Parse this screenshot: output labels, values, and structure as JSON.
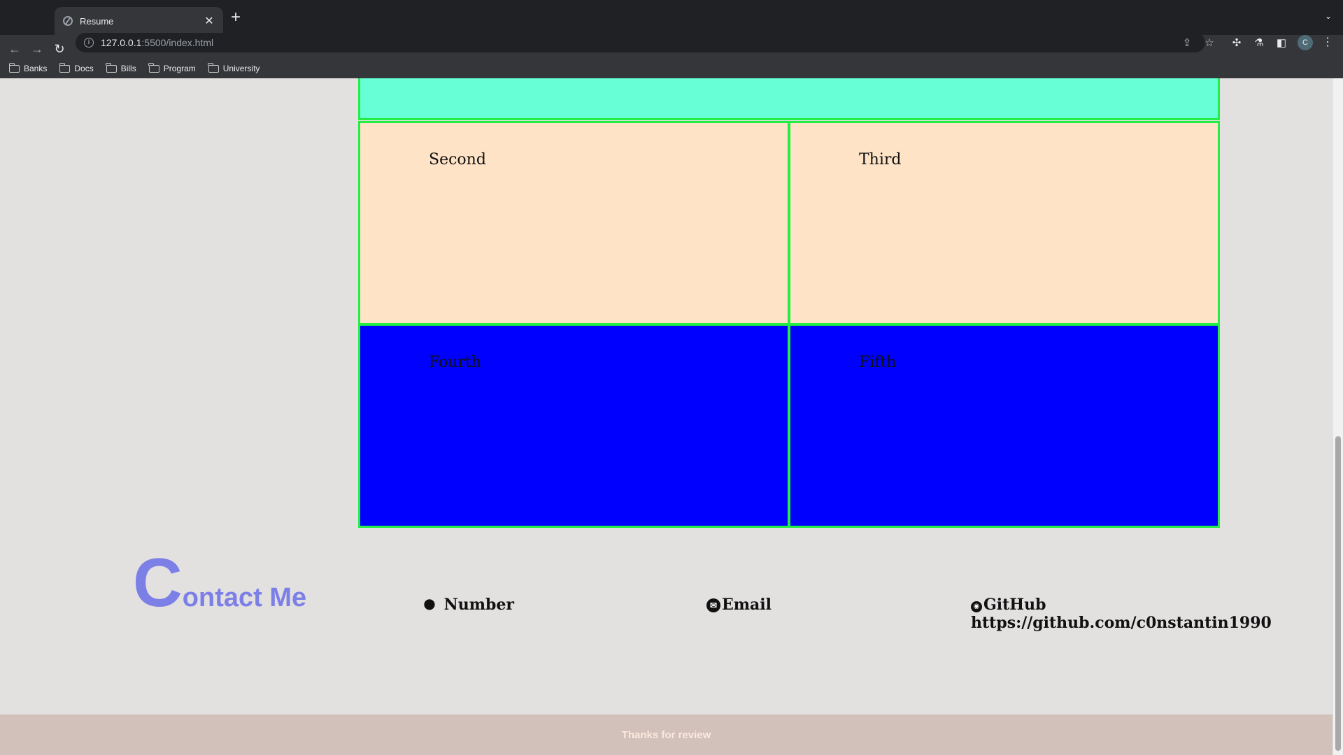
{
  "browser": {
    "tab_title": "Resume",
    "tab_close": "✕",
    "new_tab": "+",
    "url_host": "127.0.0.1",
    "url_path": ":5500/index.html",
    "profile_initial": "C",
    "bookmarks": [
      "Banks",
      "Docs",
      "Bills",
      "Program",
      "University"
    ]
  },
  "grid": {
    "second": "Second",
    "third": "Third",
    "fourth": "Fourth",
    "fifth": "Fifth"
  },
  "contact": {
    "heading_initial": "C",
    "heading_rest": "ontact Me",
    "number_label": "Number",
    "email_label": "Email",
    "github_label": "GitHub",
    "github_url": "https://github.com/c0nstantin1990"
  },
  "footer": {
    "text": "Thanks for review"
  },
  "colors": {
    "first_cell": "#66ffd6",
    "peach_cell": "#ffe3c6",
    "blue_cell": "#0000ff",
    "cell_border": "#22ee44",
    "heading": "#7c7fe6",
    "footer_bg": "#d2c0ba"
  }
}
